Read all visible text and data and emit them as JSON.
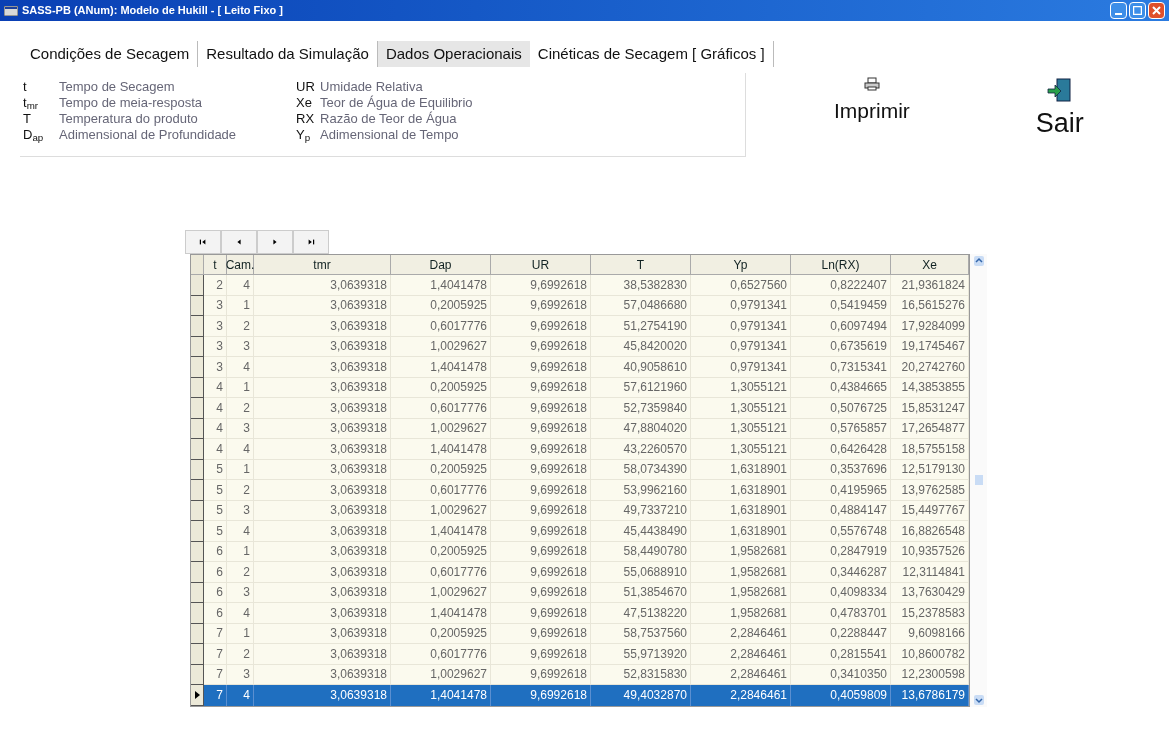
{
  "window": {
    "title": "SASS-PB (ANum): Modelo de Hukill - [ Leito Fixo ]"
  },
  "tabs": [
    {
      "label": "Condições de Secagem",
      "selected": false
    },
    {
      "label": "Resultado da Simulação",
      "selected": false
    },
    {
      "label": "Dados Operacionais",
      "selected": true
    },
    {
      "label": "Cinéticas de Secagem [ Gráficos ]",
      "selected": false
    }
  ],
  "legend": {
    "left": [
      {
        "symbol": "t",
        "meaning": "Tempo de Secagem"
      },
      {
        "symbol": "t$_{mr}$",
        "meaning": "Tempo de meia-resposta"
      },
      {
        "symbol": "T",
        "meaning": "Temperatura do produto"
      },
      {
        "symbol": "D$_{ap}$",
        "meaning": "Adimensional de Profundidade"
      }
    ],
    "right": [
      {
        "symbol": "UR",
        "meaning": "Umidade Relativa"
      },
      {
        "symbol": "Xe",
        "meaning": "Teor de Água de Equilibrio"
      },
      {
        "symbol": "RX",
        "meaning": "Razão de Teor de Água"
      },
      {
        "symbol": "Y$_{p}$",
        "meaning": "Adimensional de Tempo"
      }
    ]
  },
  "actions": [
    {
      "kind": "print",
      "label": "Imprimir"
    },
    {
      "kind": "exit",
      "label": "Sair"
    }
  ],
  "navigator": [
    {
      "kind": "first"
    },
    {
      "kind": "prior"
    },
    {
      "kind": "next"
    },
    {
      "kind": "last"
    }
  ],
  "table": {
    "columns": [
      "t",
      "Cam.",
      "tmr",
      "Dap",
      "UR",
      "T",
      "Yp",
      "Ln(RX)",
      "Xe"
    ],
    "rows": [
      {
        "selected": false,
        "cells": [
          "2",
          "4",
          "3,0639318",
          "1,4041478",
          "9,6992618",
          "38,5382830",
          "0,6527560",
          "0,8222407",
          "21,9361824"
        ]
      },
      {
        "selected": false,
        "cells": [
          "3",
          "1",
          "3,0639318",
          "0,2005925",
          "9,6992618",
          "57,0486680",
          "0,9791341",
          "0,5419459",
          "16,5615276"
        ]
      },
      {
        "selected": false,
        "cells": [
          "3",
          "2",
          "3,0639318",
          "0,6017776",
          "9,6992618",
          "51,2754190",
          "0,9791341",
          "0,6097494",
          "17,9284099"
        ]
      },
      {
        "selected": false,
        "cells": [
          "3",
          "3",
          "3,0639318",
          "1,0029627",
          "9,6992618",
          "45,8420020",
          "0,9791341",
          "0,6735619",
          "19,1745467"
        ]
      },
      {
        "selected": false,
        "cells": [
          "3",
          "4",
          "3,0639318",
          "1,4041478",
          "9,6992618",
          "40,9058610",
          "0,9791341",
          "0,7315341",
          "20,2742760"
        ]
      },
      {
        "selected": false,
        "cells": [
          "4",
          "1",
          "3,0639318",
          "0,2005925",
          "9,6992618",
          "57,6121960",
          "1,3055121",
          "0,4384665",
          "14,3853855"
        ]
      },
      {
        "selected": false,
        "cells": [
          "4",
          "2",
          "3,0639318",
          "0,6017776",
          "9,6992618",
          "52,7359840",
          "1,3055121",
          "0,5076725",
          "15,8531247"
        ]
      },
      {
        "selected": false,
        "cells": [
          "4",
          "3",
          "3,0639318",
          "1,0029627",
          "9,6992618",
          "47,8804020",
          "1,3055121",
          "0,5765857",
          "17,2654877"
        ]
      },
      {
        "selected": false,
        "cells": [
          "4",
          "4",
          "3,0639318",
          "1,4041478",
          "9,6992618",
          "43,2260570",
          "1,3055121",
          "0,6426428",
          "18,5755158"
        ]
      },
      {
        "selected": false,
        "cells": [
          "5",
          "1",
          "3,0639318",
          "0,2005925",
          "9,6992618",
          "58,0734390",
          "1,6318901",
          "0,3537696",
          "12,5179130"
        ]
      },
      {
        "selected": false,
        "cells": [
          "5",
          "2",
          "3,0639318",
          "0,6017776",
          "9,6992618",
          "53,9962160",
          "1,6318901",
          "0,4195965",
          "13,9762585"
        ]
      },
      {
        "selected": false,
        "cells": [
          "5",
          "3",
          "3,0639318",
          "1,0029627",
          "9,6992618",
          "49,7337210",
          "1,6318901",
          "0,4884147",
          "15,4497767"
        ]
      },
      {
        "selected": false,
        "cells": [
          "5",
          "4",
          "3,0639318",
          "1,4041478",
          "9,6992618",
          "45,4438490",
          "1,6318901",
          "0,5576748",
          "16,8826548"
        ]
      },
      {
        "selected": false,
        "cells": [
          "6",
          "1",
          "3,0639318",
          "0,2005925",
          "9,6992618",
          "58,4490780",
          "1,9582681",
          "0,2847919",
          "10,9357526"
        ]
      },
      {
        "selected": false,
        "cells": [
          "6",
          "2",
          "3,0639318",
          "0,6017776",
          "9,6992618",
          "55,0688910",
          "1,9582681",
          "0,3446287",
          "12,3114841"
        ]
      },
      {
        "selected": false,
        "cells": [
          "6",
          "3",
          "3,0639318",
          "1,0029627",
          "9,6992618",
          "51,3854670",
          "1,9582681",
          "0,4098334",
          "13,7630429"
        ]
      },
      {
        "selected": false,
        "cells": [
          "6",
          "4",
          "3,0639318",
          "1,4041478",
          "9,6992618",
          "47,5138220",
          "1,9582681",
          "0,4783701",
          "15,2378583"
        ]
      },
      {
        "selected": false,
        "cells": [
          "7",
          "1",
          "3,0639318",
          "0,2005925",
          "9,6992618",
          "58,7537560",
          "2,2846461",
          "0,2288447",
          "9,6098166"
        ]
      },
      {
        "selected": false,
        "cells": [
          "7",
          "2",
          "3,0639318",
          "0,6017776",
          "9,6992618",
          "55,9713920",
          "2,2846461",
          "0,2815541",
          "10,8600782"
        ]
      },
      {
        "selected": false,
        "cells": [
          "7",
          "3",
          "3,0639318",
          "1,0029627",
          "9,6992618",
          "52,8315830",
          "2,2846461",
          "0,3410350",
          "12,2300598"
        ]
      },
      {
        "selected": true,
        "cells": [
          "7",
          "4",
          "3,0639318",
          "1,4041478",
          "9,6992618",
          "49,4032870",
          "2,2846461",
          "0,4059809",
          "13,6786179"
        ]
      }
    ]
  }
}
